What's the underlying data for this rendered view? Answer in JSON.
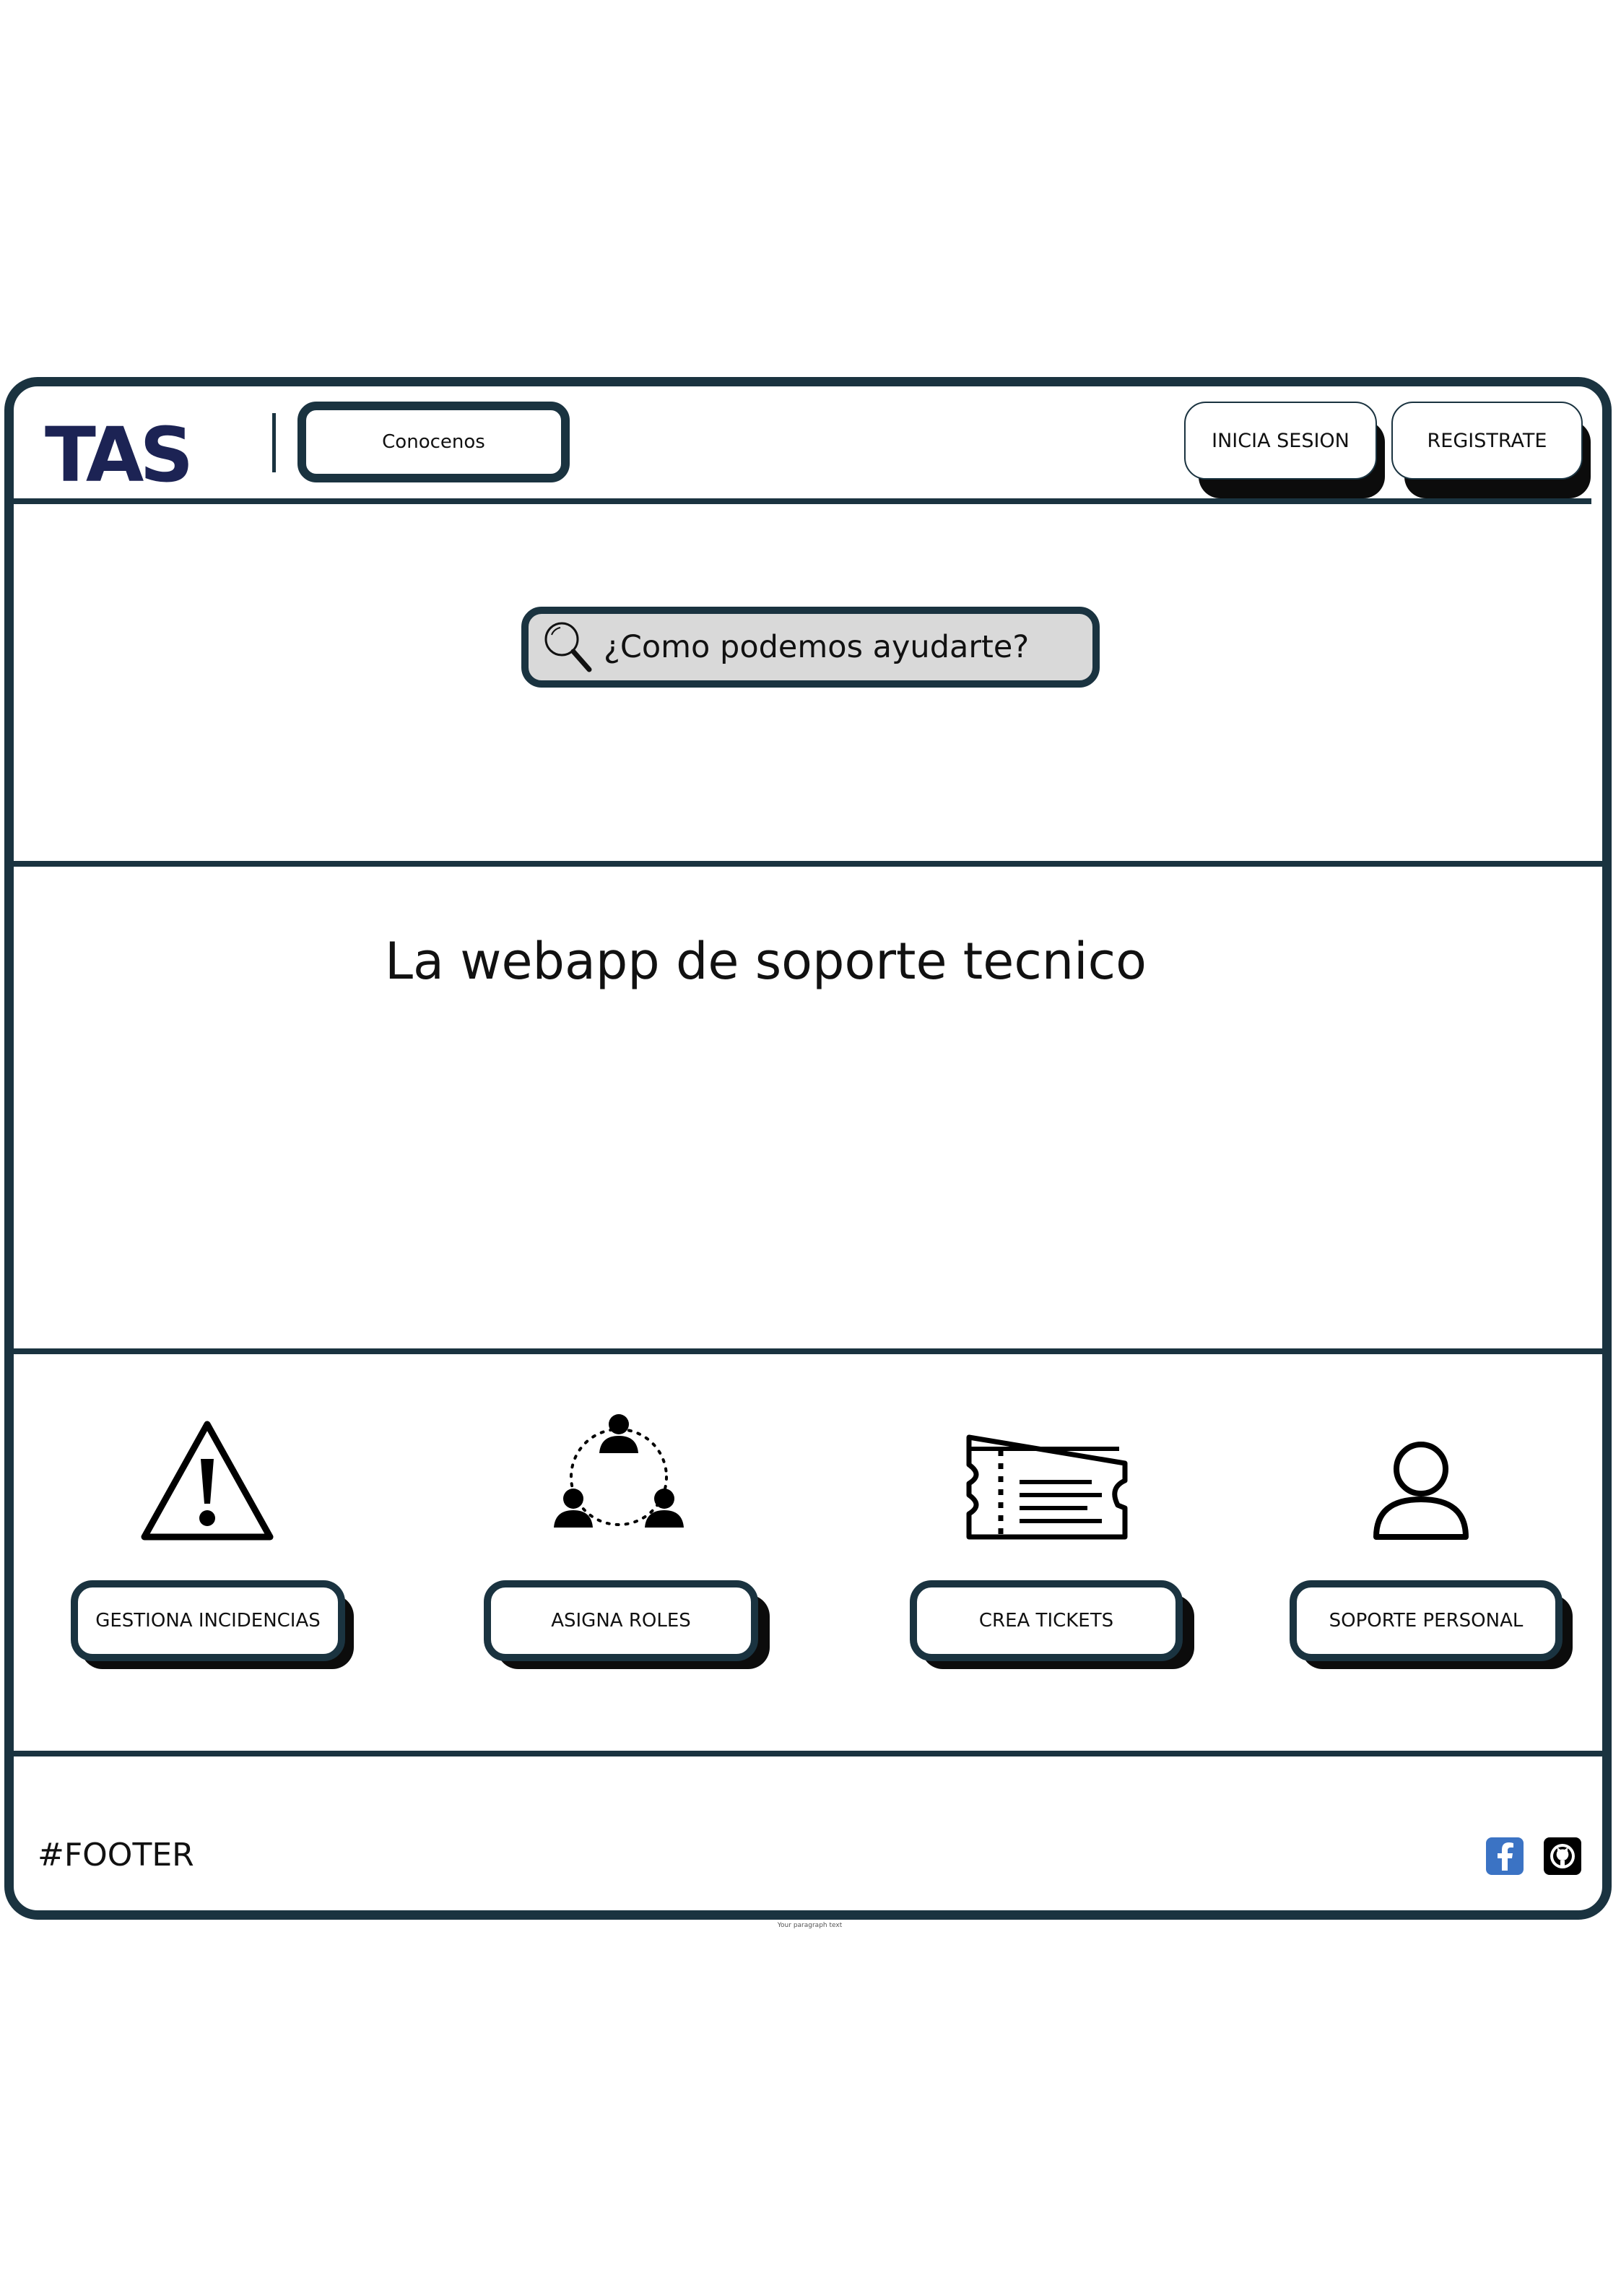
{
  "header": {
    "logo_text": "TAS",
    "nav_about_label": "Conocenos",
    "login_label": "INICIA SESION",
    "register_label": "REGISTRATE"
  },
  "search": {
    "placeholder": "¿Como podemos ayudarte?"
  },
  "hero": {
    "headline": "La webapp de soporte tecnico"
  },
  "features": [
    {
      "label": "GESTIONA INCIDENCIAS",
      "icon": "warning-icon"
    },
    {
      "label": "ASIGNA ROLES",
      "icon": "team-roles-icon"
    },
    {
      "label": "CREA TICKETS",
      "icon": "ticket-icon"
    },
    {
      "label": "SOPORTE PERSONAL",
      "icon": "user-icon"
    }
  ],
  "footer": {
    "label": "#FOOTER",
    "social": [
      "facebook-icon",
      "github-icon"
    ],
    "below_text": "Your paragraph text"
  },
  "colors": {
    "border": "#1a3340",
    "logo": "#1c2354",
    "search_bg": "#d9d9d9",
    "facebook": "#3b5998"
  }
}
